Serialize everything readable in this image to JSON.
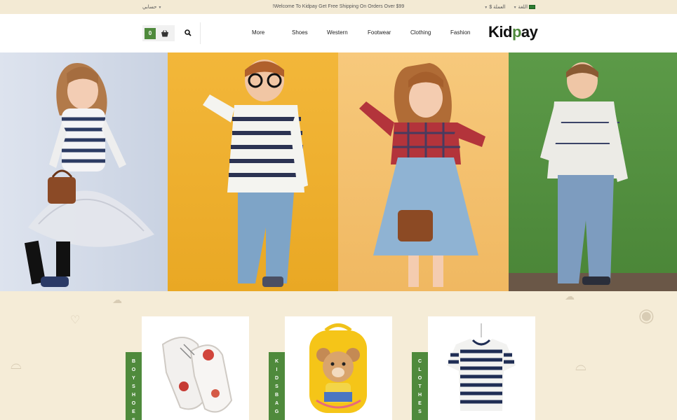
{
  "topbar": {
    "account_label": "حسابي",
    "welcome": "!Welcome To Kidpay Get Free Shipping On Orders Over $99",
    "currency_label": "$ العملة",
    "language_label": "اللغة"
  },
  "header": {
    "cart_count": "0",
    "nav": [
      "More",
      "Shoes",
      "Western",
      "Footwear",
      "Clothing",
      "Fashion"
    ],
    "logo_left": "Kid",
    "logo_p": "p",
    "logo_right": "ay"
  },
  "categories": [
    {
      "label": "BOYSHOES",
      "letters": [
        "B",
        "O",
        "Y",
        "S",
        "H",
        "O",
        "E",
        "S"
      ]
    },
    {
      "label": "KIDSBAG",
      "letters": [
        "K",
        "I",
        "D",
        "S",
        "B",
        "A",
        "G"
      ]
    },
    {
      "label": "CLOTHES",
      "letters": [
        "C",
        "L",
        "O",
        "T",
        "H",
        "E",
        "S"
      ]
    }
  ],
  "colors": {
    "accent": "#4f8a3c",
    "page_bg": "#f5ecd7"
  }
}
